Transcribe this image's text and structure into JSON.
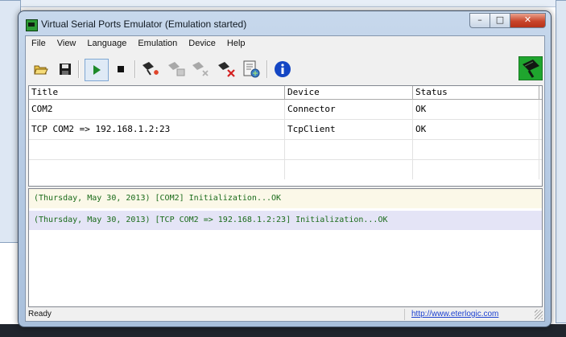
{
  "window": {
    "title": "Virtual Serial Ports Emulator (Emulation started)",
    "caption_buttons": {
      "minimize": "–",
      "maximize": "□",
      "close": "✕"
    }
  },
  "menu": [
    "File",
    "View",
    "Language",
    "Emulation",
    "Device",
    "Help"
  ],
  "toolbar": {
    "buttons": [
      {
        "name": "open-icon",
        "state": "normal"
      },
      {
        "name": "save-icon",
        "state": "normal"
      },
      {
        "name": "start-icon",
        "state": "pressed"
      },
      {
        "name": "stop-icon",
        "state": "normal"
      },
      {
        "name": "new-device-icon",
        "state": "normal"
      },
      {
        "name": "edit-device-icon",
        "state": "disabled"
      },
      {
        "name": "reset-device-icon",
        "state": "disabled"
      },
      {
        "name": "delete-device-icon",
        "state": "normal"
      },
      {
        "name": "device-properties-icon",
        "state": "normal"
      },
      {
        "name": "info-icon",
        "state": "normal"
      }
    ],
    "logo": "serial-port-logo-icon"
  },
  "devices": {
    "columns": [
      "Title",
      "Device",
      "Status"
    ],
    "rows": [
      {
        "title": "COM2",
        "device": "Connector",
        "status": "OK"
      },
      {
        "title": "TCP COM2 => 192.168.1.2:23",
        "device": "TcpClient",
        "status": "OK"
      }
    ]
  },
  "log": [
    "(Thursday, May 30, 2013) [COM2] Initialization...OK",
    "(Thursday, May 30, 2013) [TCP COM2 => 192.168.1.2:23] Initialization...OK"
  ],
  "status": {
    "text": "Ready",
    "link": "http://www.eterlogic.com"
  },
  "colors": {
    "log_text": "#1a6b1a",
    "close_button": "#c9452b",
    "link": "#1a3fd0"
  }
}
